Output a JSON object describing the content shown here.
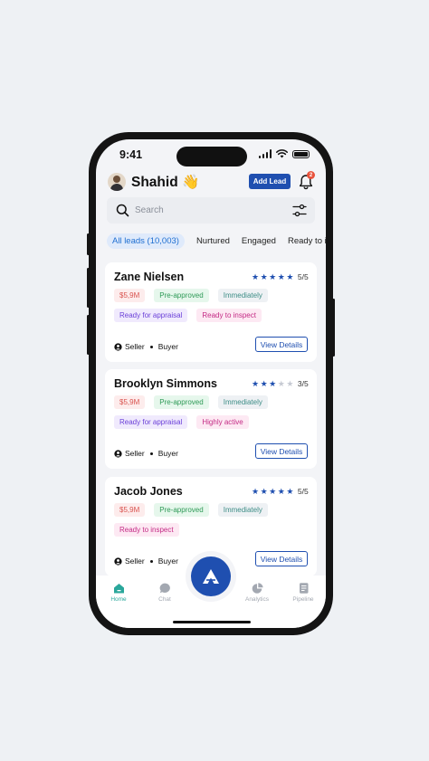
{
  "status_bar": {
    "time": "9:41"
  },
  "header": {
    "greeting_name": "Shahid 👋",
    "add_lead_label": "Add Lead",
    "notification_count": "2"
  },
  "search": {
    "placeholder": "Search"
  },
  "tabs": [
    {
      "label": "All leads (10,003)",
      "active": true
    },
    {
      "label": "Nurtured",
      "active": false
    },
    {
      "label": "Engaged",
      "active": false
    },
    {
      "label": "Ready to inspect",
      "active": false
    }
  ],
  "leads": [
    {
      "name": "Zane Nielsen",
      "rating": 5,
      "rating_label": "5/5",
      "tags": [
        {
          "label": "$5,9M",
          "kind": "price"
        },
        {
          "label": "Pre-approved",
          "kind": "approved"
        },
        {
          "label": "Immediately",
          "kind": "time"
        },
        {
          "label": "Ready for appraisal",
          "kind": "appraisal"
        },
        {
          "label": "Ready to inspect",
          "kind": "inspect"
        }
      ],
      "roles": [
        "Seller",
        "Buyer"
      ],
      "action_label": "View Details"
    },
    {
      "name": "Brooklyn Simmons",
      "rating": 3,
      "rating_label": "3/5",
      "tags": [
        {
          "label": "$5,9M",
          "kind": "price"
        },
        {
          "label": "Pre-approved",
          "kind": "approved"
        },
        {
          "label": "Immediately",
          "kind": "time"
        },
        {
          "label": "Ready for appraisal",
          "kind": "appraisal"
        },
        {
          "label": "Highly active",
          "kind": "active"
        }
      ],
      "roles": [
        "Seller",
        "Buyer"
      ],
      "action_label": "View Details"
    },
    {
      "name": "Jacob Jones",
      "rating": 5,
      "rating_label": "5/5",
      "tags": [
        {
          "label": "$5,9M",
          "kind": "price"
        },
        {
          "label": "Pre-approved",
          "kind": "approved"
        },
        {
          "label": "Immediately",
          "kind": "time"
        },
        {
          "label": "Ready to inspect",
          "kind": "inspect"
        }
      ],
      "roles": [
        "Seller",
        "Buyer"
      ],
      "action_label": "View Details"
    }
  ],
  "bottom_nav": [
    {
      "label": "Home",
      "icon": "home-icon",
      "active": true
    },
    {
      "label": "Chat",
      "icon": "chat-icon",
      "active": false
    },
    {
      "label": "Analytics",
      "icon": "pie-chart-icon",
      "active": false
    },
    {
      "label": "Pipeline",
      "icon": "document-icon",
      "active": false
    }
  ],
  "colors": {
    "primary": "#1f4fb0",
    "accent_teal": "#2aa79b",
    "badge_red": "#e8533d"
  }
}
